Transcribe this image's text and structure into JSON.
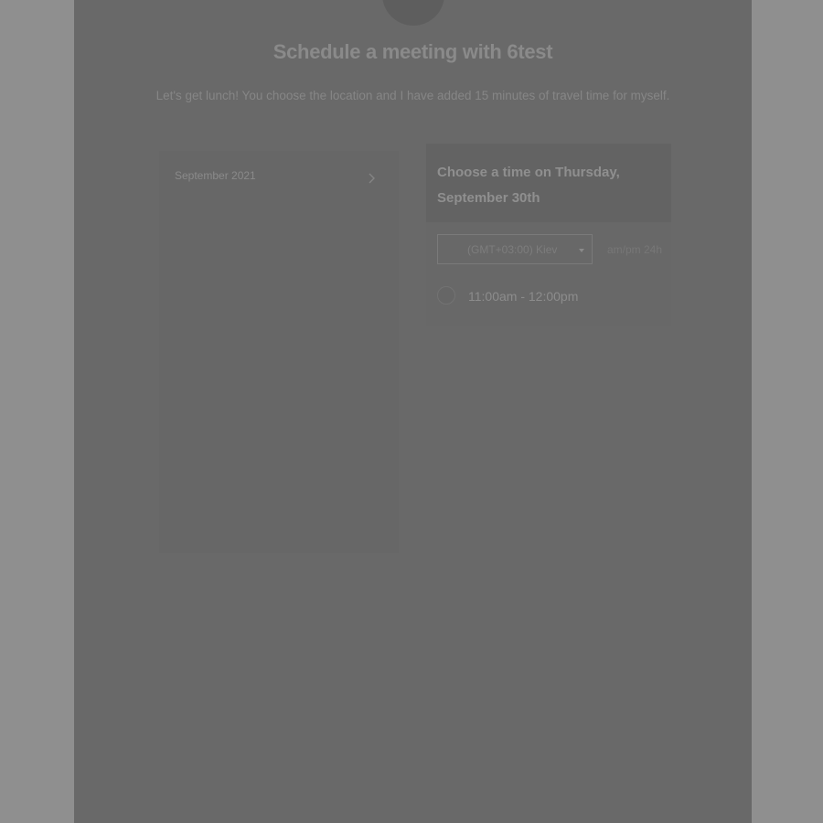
{
  "header": {
    "title": "Schedule a meeting with 6test",
    "description": "Let's get lunch! You choose the location and I have added 15 minutes of travel time for myself."
  },
  "calendar": {
    "month_label": "September 2021",
    "next_icon": "chevron-right-icon"
  },
  "time_panel": {
    "heading": "Choose a time on Thursday, September 30th",
    "timezone": {
      "value": "(GMT+03:00) Kiev",
      "icon": "chevron-down-icon"
    },
    "format_toggle": "am/pm  24h",
    "slots": [
      {
        "label": "11:00am - 12:00pm"
      }
    ]
  },
  "colors": {
    "overlay_background": "#696969",
    "outer_background": "#8f8f8f"
  }
}
